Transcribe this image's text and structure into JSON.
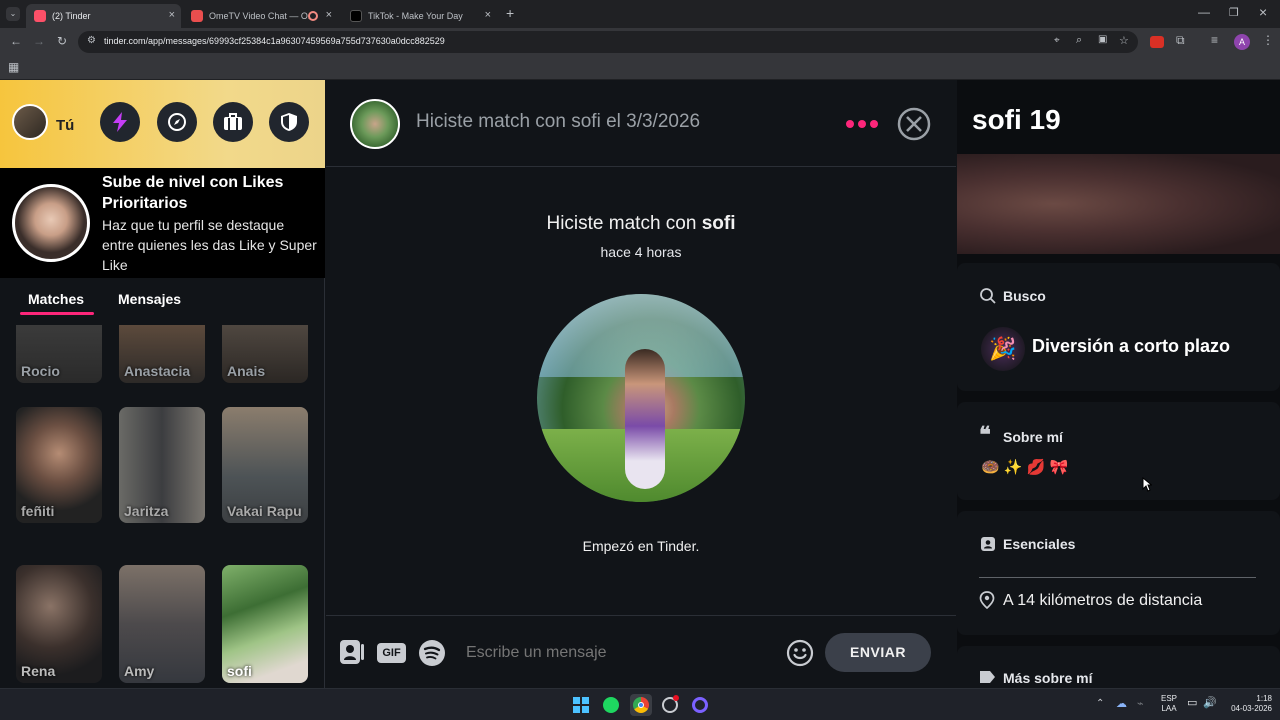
{
  "browser": {
    "tabs": [
      {
        "title": "(2) Tinder",
        "active": true
      },
      {
        "title": "OmeTV Video Chat — Ome",
        "active": false
      },
      {
        "title": "TikTok - Make Your Day",
        "active": false
      }
    ],
    "url": "tinder.com/app/messages/69993cf25384c1a96307459569a755d737630a0dcc882529",
    "profile_letter": "A"
  },
  "left": {
    "user_label": "Tú",
    "promo_title": "Sube de nivel con Likes Prioritarios",
    "promo_text": "Haz que tu perfil se destaque entre quienes les das Like y Super Like",
    "tabs": [
      "Matches",
      "Mensajes"
    ],
    "matches": [
      "Rocio",
      "Anastacia",
      "Anais",
      "feñiti",
      "Jaritza",
      "Vakai Rapu",
      "Rena",
      "Amy",
      "sofi"
    ]
  },
  "center": {
    "header_title": "Hiciste match con sofi el 3/3/2026",
    "match_prefix": "Hiciste match con ",
    "match_name": "sofi",
    "match_time": "hace 4 horas",
    "started": "Empezó en Tinder.",
    "composer_placeholder": "Escribe un mensaje",
    "send_label": "ENVIAR",
    "gif_label": "GIF"
  },
  "right": {
    "name_age": "sofi 19",
    "looking_title": "Busco",
    "looking_value": "Diversión a corto plazo",
    "about_title": "Sobre mí",
    "about_emojis": "🍩 ✨ 💋 🎀",
    "essentials_title": "Esenciales",
    "distance": "A 14 kilómetros de distancia",
    "more_title": "Más sobre mí"
  },
  "taskbar": {
    "lang1": "ESP",
    "lang2": "LAA",
    "time": "1:18",
    "date": "04-03-2026"
  },
  "colors": {
    "tinder_accent": "#fd267a",
    "gold": "#f6c53d",
    "panel_bg": "#111418",
    "send_bg": "#3b404a"
  }
}
